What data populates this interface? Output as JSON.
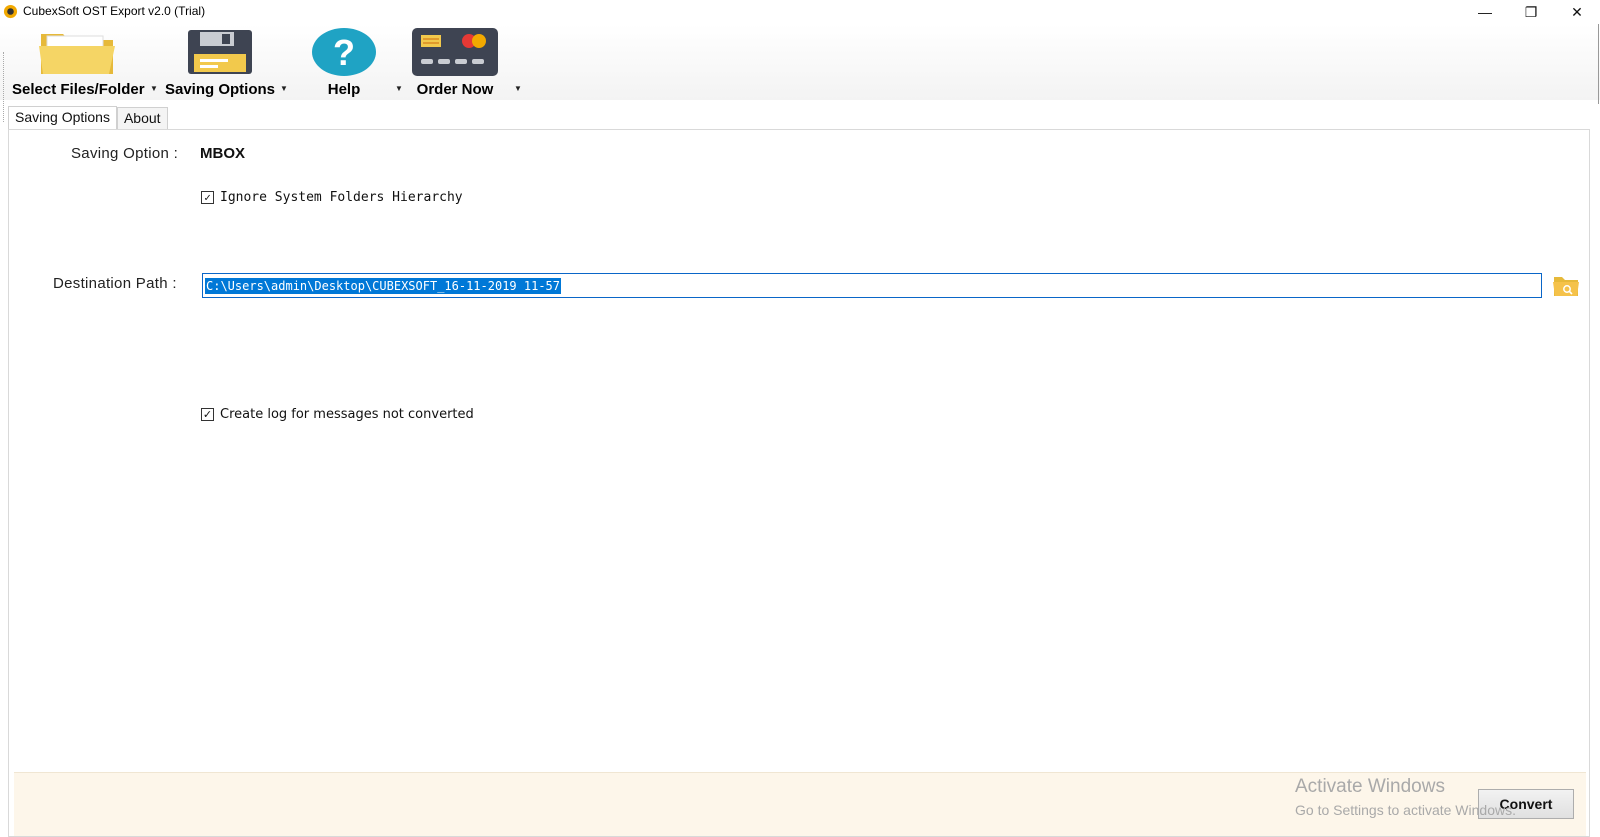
{
  "window": {
    "title": "CubexSoft OST Export v2.0 (Trial)",
    "controls": {
      "minimize": "—",
      "restore": "❐",
      "close": "✕"
    }
  },
  "toolbar": {
    "items": [
      {
        "label": "Select Files/Folder",
        "icon": "folder-icon"
      },
      {
        "label": "Saving Options",
        "icon": "floppy-disk-icon"
      },
      {
        "label": "Help",
        "icon": "help-icon"
      },
      {
        "label": "Order Now",
        "icon": "credit-card-icon"
      }
    ],
    "dropdown_glyph": "▼"
  },
  "tabs": [
    {
      "label": "Saving Options",
      "active": true
    },
    {
      "label": "About",
      "active": false
    }
  ],
  "saving": {
    "option_label": "Saving Option :",
    "option_value": "MBOX",
    "ignore_hierarchy_label": "Ignore System Folders Hierarchy",
    "ignore_hierarchy_checked": true
  },
  "destination": {
    "label": "Destination Path :",
    "value": "C:\\Users\\admin\\Desktop\\CUBEXSOFT_16-11-2019 11-57"
  },
  "log": {
    "label": "Create log for messages not converted",
    "checked": true
  },
  "footer": {
    "convert_label": "Convert",
    "watermark_title": "Activate Windows",
    "watermark_sub": "Go to Settings to activate Windows."
  },
  "colors": {
    "selection": "#0078d7",
    "footer_bg": "#fdf6ea",
    "folder": "#f2c94c",
    "help": "#1fa3c4"
  }
}
